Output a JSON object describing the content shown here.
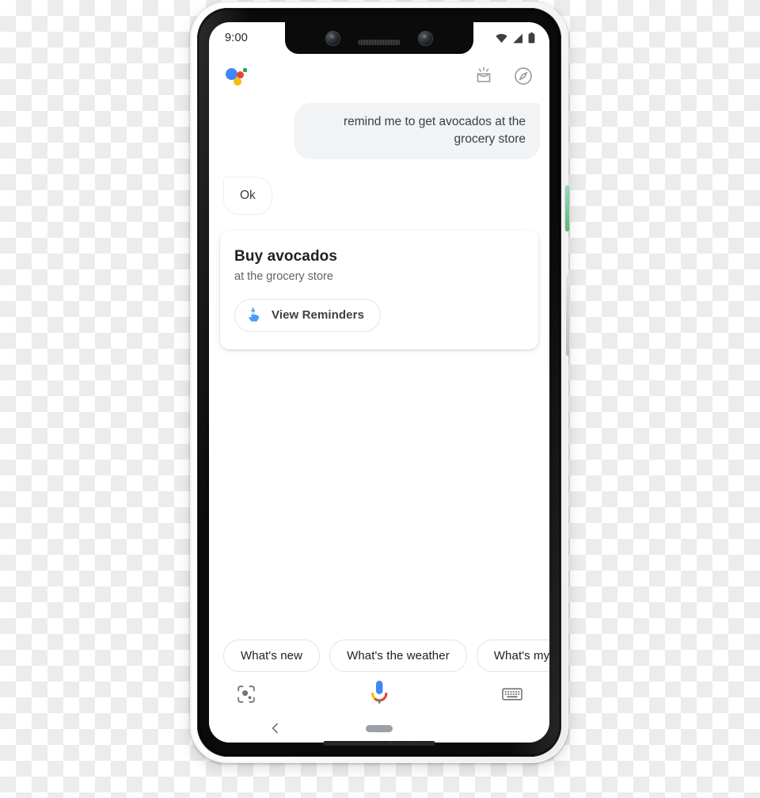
{
  "device": {
    "name": "pixel-3-xl",
    "power_button_color": "#73c993",
    "volume_button_color": "#cfcfcf",
    "frame_color": "#0b0b0b"
  },
  "status_bar": {
    "time": "9:00",
    "icons": [
      "wifi-icon",
      "cellular-signal-icon",
      "battery-icon"
    ]
  },
  "header": {
    "logo": "google-assistant-logo",
    "logo_colors": {
      "blue": "#4285f4",
      "red": "#ea4335",
      "yellow": "#fbbc04",
      "green": "#34a853"
    },
    "actions": [
      {
        "name": "snapshot-icon",
        "label": "Snapshot"
      },
      {
        "name": "explore-icon",
        "label": "Explore"
      }
    ]
  },
  "conversation": {
    "user_message": "remind me to get avocados at the grocery store",
    "assistant_reply": "Ok",
    "card": {
      "title": "Buy avocados",
      "subtitle": "at the grocery store",
      "button": {
        "label": "View Reminders",
        "icon": "reminder-finger-string-icon",
        "icon_color": "#4a9df8"
      }
    }
  },
  "suggestion_chips": [
    "What's new",
    "What's the weather",
    "What's my wa"
  ],
  "action_bar": [
    {
      "name": "google-lens-icon",
      "label": "Google Lens"
    },
    {
      "name": "google-mic-icon",
      "label": "Microphone"
    },
    {
      "name": "keyboard-icon",
      "label": "Keyboard"
    }
  ],
  "nav_bar": {
    "back": "back-chevron-icon",
    "home": "home-pill-icon"
  }
}
